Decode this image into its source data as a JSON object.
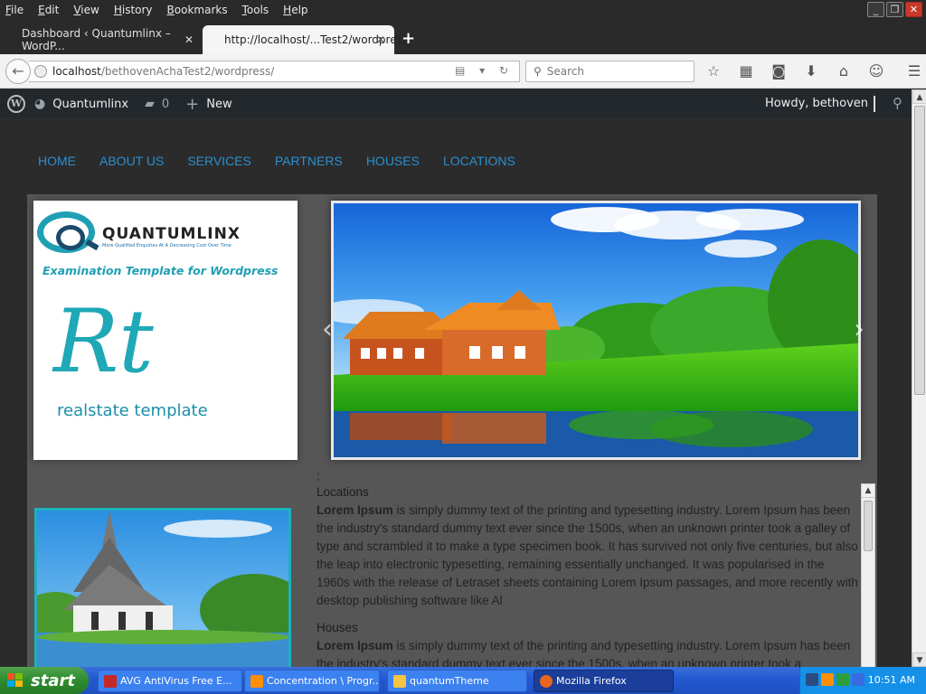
{
  "menu": {
    "items": [
      "File",
      "Edit",
      "View",
      "History",
      "Bookmarks",
      "Tools",
      "Help"
    ],
    "underline": [
      "F",
      "E",
      "V",
      "H",
      "B",
      "T",
      "H"
    ]
  },
  "tabs": [
    {
      "title": "Dashboard ‹ Quantumlinx – WordP...",
      "active": false
    },
    {
      "title": "http://localhost/...Test2/wordpress/",
      "active": true
    }
  ],
  "urlbar": {
    "host": "localhost",
    "path": "/bethovenAchaTest2/wordpress/"
  },
  "searchbar": {
    "placeholder": "Search"
  },
  "wpadmin": {
    "site_name": "Quantumlinx",
    "comments": "0",
    "new_label": "New",
    "howdy": "Howdy, bethoven"
  },
  "sitenav": {
    "items": [
      "HOME",
      "ABOUT US",
      "SERVICES",
      "PARTNERS",
      "HOUSES",
      "LOCATIONS"
    ]
  },
  "logo": {
    "brand": "QUANTUMLINX",
    "tagline": "More Qualified Enquiries At A Decreasing Cost Over Time",
    "subtitle": "Examination Template for Wordpress",
    "monogram": "Rt",
    "label": "realstate template"
  },
  "content": {
    "semicolon": ";",
    "sections": [
      {
        "heading": "Locations",
        "bold": "Lorem Ipsum",
        "text": " is simply dummy text of the printing and typesetting industry. Lorem Ipsum has been the industry's standard dummy text ever since the 1500s, when an unknown printer took a galley of type and scrambled it to make a type specimen book. It has survived not only five centuries, but also the leap into electronic typesetting, remaining essentially unchanged. It was popularised in the 1960s with the release of Letraset sheets containing Lorem Ipsum passages, and more recently with desktop publishing software like Al"
      },
      {
        "heading": "Houses",
        "bold": "Lorem Ipsum",
        "text": " is simply dummy text of the printing and typesetting industry. Lorem Ipsum has been the industry's standard dummy text ever since the 1500s, when an unknown printer took a"
      }
    ]
  },
  "taskbar": {
    "start": "start",
    "buttons": [
      {
        "label": "AVG AntiVirus Free E...",
        "icon_color": "#c62828",
        "active": false
      },
      {
        "label": "Concentration \\ Progr...",
        "icon_color": "#ff8f00",
        "active": false
      },
      {
        "label": "quantumTheme",
        "icon_color": "#f4c542",
        "active": false
      },
      {
        "label": "Mozilla Firefox",
        "icon_color": "#e8671c",
        "active": true
      }
    ],
    "clock": "10:51 AM"
  },
  "colors": {
    "nav_link": "#2a8fd0",
    "wp_bar": "#23282d",
    "content_bg": "#565656",
    "accent_teal": "#1fa8b6"
  }
}
